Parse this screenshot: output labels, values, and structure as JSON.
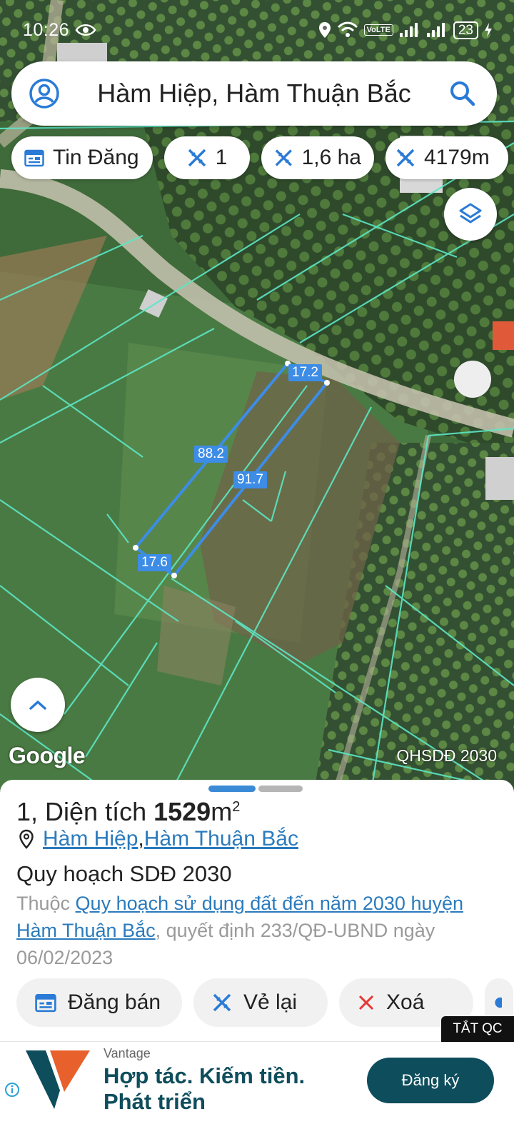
{
  "status_bar": {
    "time": "10:26",
    "network": "VoLTE",
    "battery": "23"
  },
  "search": {
    "query": "Hàm Hiệp, Hàm Thuận Bắc"
  },
  "chips": [
    {
      "label": "Tin Đăng",
      "icon": "calendar-icon"
    },
    {
      "label": "1",
      "icon": "measure-icon"
    },
    {
      "label": "1,6 ha",
      "icon": "measure-icon"
    },
    {
      "label": "4179m",
      "icon": "measure-icon"
    }
  ],
  "map": {
    "attribution": "Google",
    "plan_label": "QHSDĐ 2030",
    "measurements": [
      "17.2",
      "88.2",
      "91.7",
      "17.6"
    ],
    "colors": {
      "parcel_lines": "#5ce6c4",
      "selected_parcel": "#3d8ce6"
    }
  },
  "parcel": {
    "number_prefix": "1, Diện tích ",
    "area_value": "1529",
    "area_unit": "m",
    "area_sup": "2",
    "commune": "Hàm Hiệp",
    "separator": ", ",
    "district": "Hàm Thuận Bắc",
    "plan_title": "Quy hoạch SDĐ 2030",
    "desc_prefix": "Thuộc ",
    "desc_link": "Quy hoạch sử dụng đất đến năm 2030 huyện Hàm Thuận Bắc",
    "desc_suffix": ", quyết định 233/QĐ-UBND ngày 06/02/2023"
  },
  "actions": [
    {
      "label": "Đăng bán",
      "icon": "calendar-icon"
    },
    {
      "label": "Vẻ lại",
      "icon": "measure-icon"
    },
    {
      "label": "Xoá",
      "icon": "close-icon"
    }
  ],
  "ad": {
    "close_label": "TẮT QC",
    "brand": "Vantage",
    "headline_1": "Hợp tác. Kiếm tiền.",
    "headline_2": "Phát triển",
    "cta": "Đăng ký"
  }
}
